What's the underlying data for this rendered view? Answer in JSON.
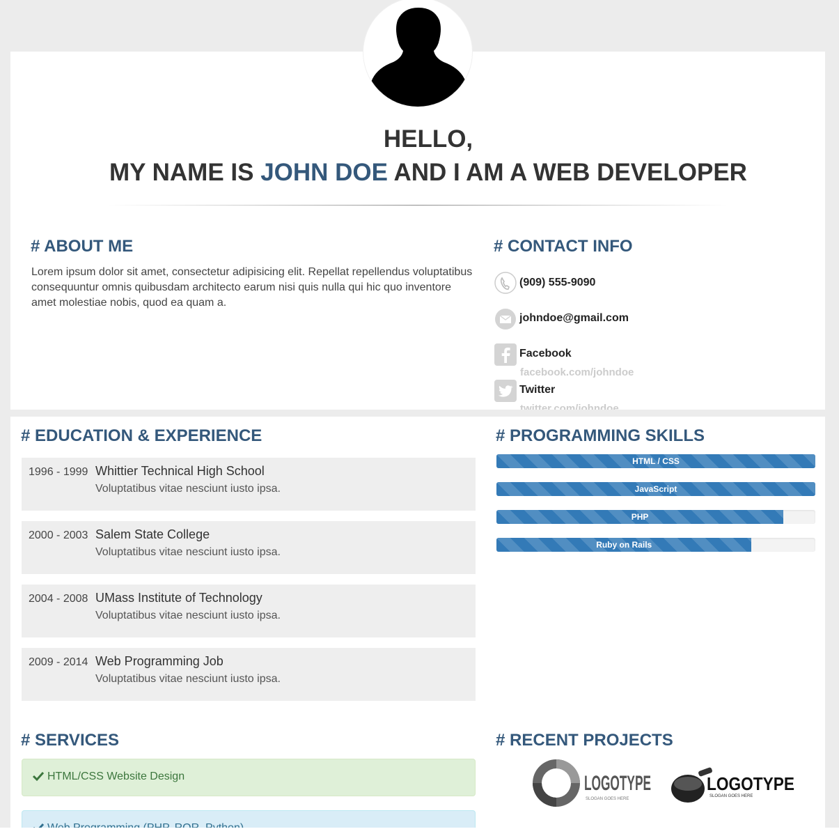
{
  "header": {
    "hello": "HELLO,",
    "name_prefix": "MY NAME IS",
    "name": "JOHN DOE",
    "name_suffix": "AND I AM A WEB DEVELOPER"
  },
  "about": {
    "title": "# ABOUT ME",
    "text": "Lorem ipsum dolor sit amet, consectetur adipisicing elit. Repellat repellendus voluptatibus consequuntur omnis quibusdam architecto earum nisi quis nulla qui hic quo inventore amet molestiae nobis, quod ea quam a."
  },
  "contact": {
    "title": "# CONTACT INFO",
    "phone": "(909) 555-9090",
    "email": "johndoe@gmail.com",
    "facebook_label": "Facebook",
    "facebook_url": "facebook.com/johndoe",
    "twitter_label": "Twitter",
    "twitter_url": "twitter.com/johndoe",
    "icons": [
      "phone-icon",
      "mail-icon",
      "facebook-icon",
      "twitter-icon"
    ]
  },
  "education": {
    "title": "# EDUCATION & EXPERIENCE",
    "items": [
      {
        "years": "1996 - 1999",
        "school": "Whittier Technical High School",
        "desc": "Voluptatibus vitae nesciunt iusto ipsa."
      },
      {
        "years": "2000 - 2003",
        "school": "Salem State College",
        "desc": "Voluptatibus vitae nesciunt iusto ipsa."
      },
      {
        "years": "2004 - 2008",
        "school": "UMass Institute of Technology",
        "desc": "Voluptatibus vitae nesciunt iusto ipsa."
      },
      {
        "years": "2009 - 2014",
        "school": "Web Programming Job",
        "desc": "Voluptatibus vitae nesciunt iusto ipsa."
      }
    ]
  },
  "skills": {
    "title": "# PROGRAMMING SKILLS",
    "items": [
      {
        "name": "HTML / CSS",
        "percent": 100
      },
      {
        "name": "JavaScript",
        "percent": 100
      },
      {
        "name": "PHP",
        "percent": 90
      },
      {
        "name": "Ruby on Rails",
        "percent": 80
      }
    ],
    "bar_color": "#337ab7"
  },
  "services": {
    "title": "# SERVICES",
    "items": [
      {
        "label": "HTML/CSS Website Design",
        "style": "green"
      },
      {
        "label": "Web Programming (PHP, ROR, Python)",
        "style": "blue"
      }
    ]
  },
  "projects": {
    "title": "# RECENT PROJECTS",
    "logos": [
      {
        "word": "LOGOTYPE",
        "slogan": "SLOGAN GOES HERE"
      },
      {
        "word": "LOGOTYPE",
        "slogan": "SLOGAN GOES HERE"
      }
    ]
  },
  "colors": {
    "accent": "#34587b",
    "background": "#ececec"
  }
}
